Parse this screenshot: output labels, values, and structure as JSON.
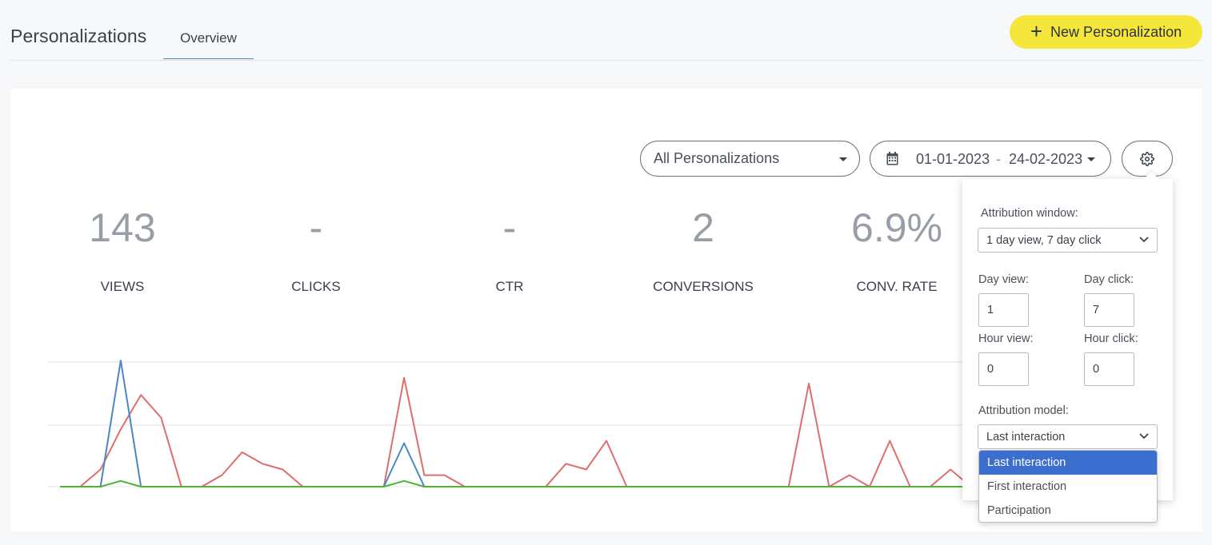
{
  "header": {
    "title": "Personalizations",
    "tab_overview": "Overview",
    "new_button_label": "New Personalization"
  },
  "filters": {
    "personalization_select": "All Personalizations",
    "date_start": "01-01-2023",
    "date_separator": "-",
    "date_end": "24-02-2023"
  },
  "stats": [
    {
      "value": "143",
      "label": "VIEWS"
    },
    {
      "value": "-",
      "label": "CLICKS"
    },
    {
      "value": "-",
      "label": "CTR"
    },
    {
      "value": "2",
      "label": "CONVERSIONS"
    },
    {
      "value": "6.9%",
      "label": "CONV. RATE"
    }
  ],
  "settings": {
    "attribution_window_label": "Attribution window:",
    "attribution_window_value": "1 day view, 7 day click",
    "day_view_label": "Day view:",
    "day_view_value": "1",
    "day_click_label": "Day click:",
    "day_click_value": "7",
    "hour_view_label": "Hour view:",
    "hour_view_value": "0",
    "hour_click_label": "Hour click:",
    "hour_click_value": "0",
    "attribution_model_label": "Attribution model:",
    "attribution_model_value": "Last interaction",
    "attribution_model_options": [
      "Last interaction",
      "First interaction",
      "Participation"
    ]
  },
  "colors": {
    "accent_yellow": "#f4e63a",
    "series_red": "#e06c6c",
    "series_blue": "#4a86c8",
    "series_green": "#4cb534",
    "selected_option": "#3b6fcf"
  },
  "chart_data": {
    "type": "line",
    "x": [
      0,
      1,
      2,
      3,
      4,
      5,
      6,
      7,
      8,
      9,
      10,
      11,
      12,
      13,
      14,
      15,
      16,
      17,
      18,
      19,
      20,
      21,
      22,
      23,
      24,
      25,
      26,
      27,
      28,
      29,
      30,
      31,
      32,
      33,
      34,
      35,
      36,
      37,
      38,
      39,
      40,
      41,
      42,
      43,
      44,
      45,
      46
    ],
    "ylim": [
      0,
      10
    ],
    "series": [
      {
        "values": [
          0,
          0,
          1.5,
          5,
          8,
          6,
          0,
          0,
          1,
          3,
          2,
          1.5,
          0,
          0,
          0,
          0,
          0,
          9.5,
          1,
          1,
          0,
          0,
          0,
          0,
          0,
          2,
          1.5,
          4,
          0,
          0,
          0,
          0,
          0,
          0,
          0,
          0,
          0,
          9,
          0,
          1,
          0,
          4,
          0,
          0,
          1.5,
          0,
          0
        ]
      },
      {
        "values": [
          0,
          0,
          0,
          11,
          0,
          0,
          0,
          0,
          0,
          0,
          0,
          0,
          0,
          0,
          0,
          0,
          0,
          3.8,
          0,
          0,
          0,
          0,
          0,
          0,
          0,
          0,
          0,
          0,
          0,
          0,
          0,
          0,
          0,
          0,
          0,
          0,
          0,
          0,
          0,
          0,
          0,
          0,
          0,
          0,
          0,
          0,
          0
        ]
      },
      {
        "values": [
          0,
          0,
          0,
          0.5,
          0,
          0,
          0,
          0,
          0,
          0,
          0,
          0,
          0,
          0,
          0,
          0,
          0,
          0.5,
          0,
          0,
          0,
          0,
          0,
          0,
          0,
          0,
          0,
          0,
          0,
          0,
          0,
          0,
          0,
          0,
          0,
          0,
          0,
          0,
          0,
          0,
          0,
          0,
          0,
          0,
          0,
          0,
          0
        ]
      }
    ]
  }
}
